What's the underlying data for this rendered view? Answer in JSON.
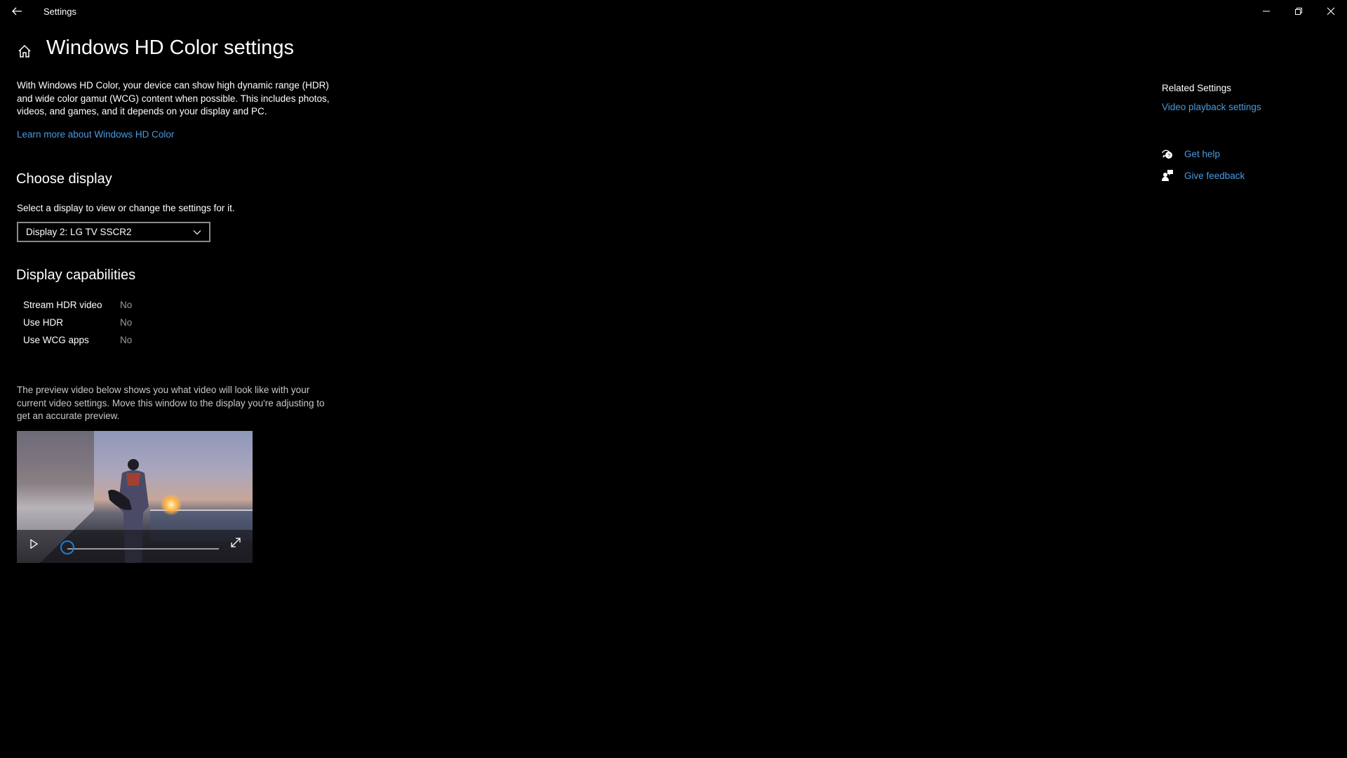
{
  "window": {
    "title": "Settings",
    "controls": {
      "minimize": "minimize",
      "restore": "restore",
      "close": "close"
    }
  },
  "header": {
    "title": "Windows HD Color settings"
  },
  "intro": {
    "description": "With Windows HD Color, your device can show high dynamic range (HDR) and wide color gamut (WCG) content when possible. This includes photos, videos, and games, and it depends on your display and PC.",
    "learn_more_link": "Learn more about Windows HD Color"
  },
  "choose_display": {
    "heading": "Choose display",
    "instruction": "Select a display to view or change the settings for it.",
    "selected": "Display 2: LG TV SSCR2"
  },
  "capabilities": {
    "heading": "Display capabilities",
    "rows": [
      {
        "label": "Stream HDR video",
        "value": "No"
      },
      {
        "label": "Use HDR",
        "value": "No"
      },
      {
        "label": "Use WCG apps",
        "value": "No"
      }
    ]
  },
  "preview": {
    "description": "The preview video below shows you what video will look like with your current video settings. Move this window to the display you're adjusting to get an accurate preview.",
    "progress": 0
  },
  "related": {
    "heading": "Related Settings",
    "links": [
      {
        "label": "Video playback settings"
      }
    ]
  },
  "support": {
    "get_help": "Get help",
    "give_feedback": "Give feedback"
  },
  "colors": {
    "accent": "#4a9ae0",
    "slider_thumb": "#1a7fd4",
    "background": "#000000"
  }
}
